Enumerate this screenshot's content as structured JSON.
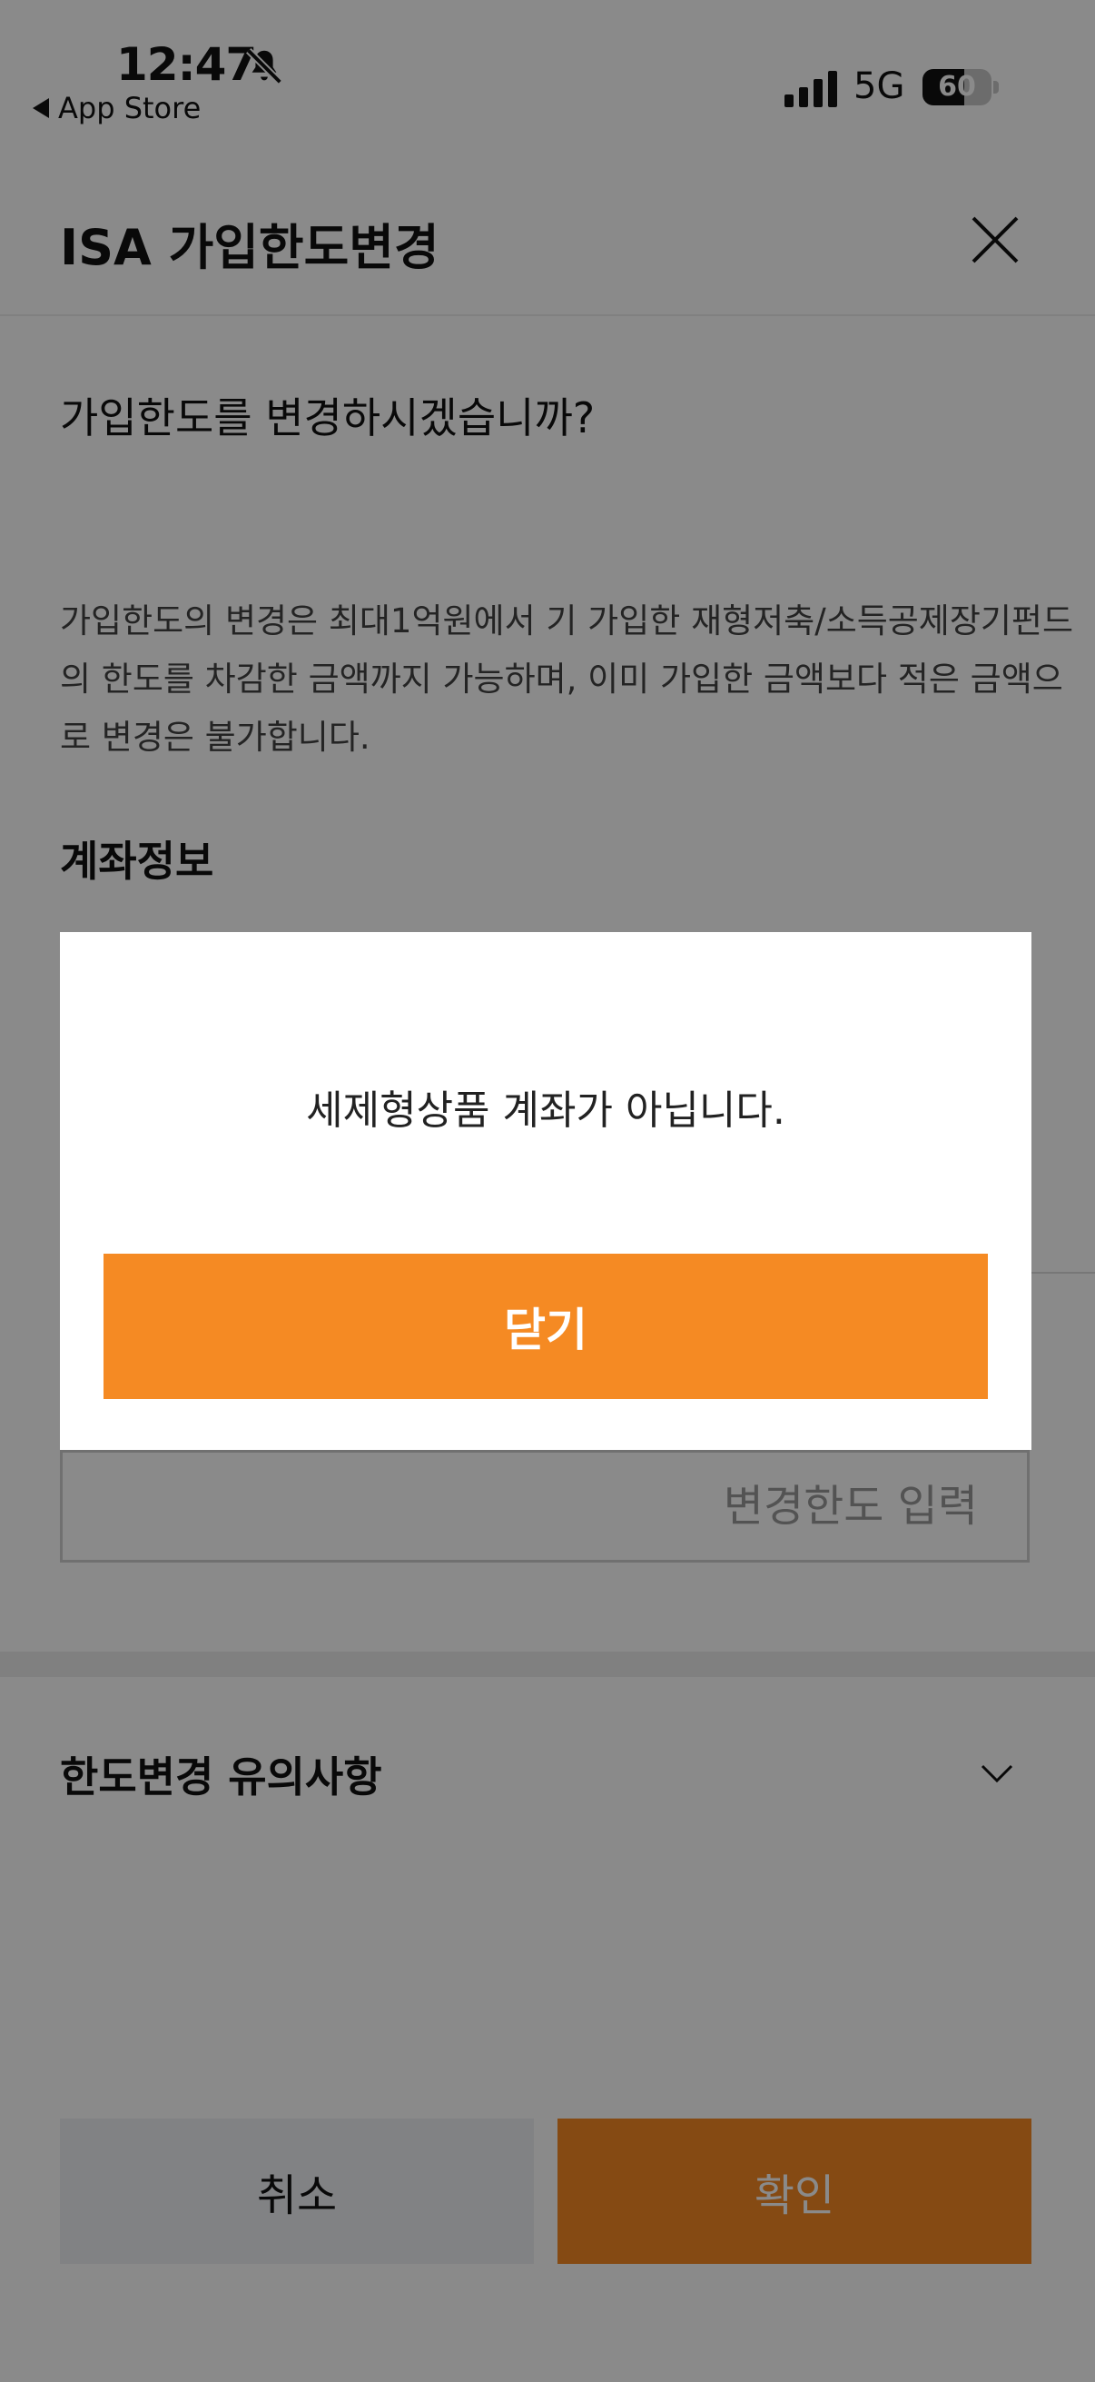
{
  "status_bar": {
    "time": "12:47",
    "back_label": "App Store",
    "network": "5G",
    "battery_level": "60",
    "battery_fraction": 0.6
  },
  "header": {
    "title": "ISA 가입한도변경"
  },
  "content": {
    "question": "가입한도를 변경하시겠습니까?",
    "description": "가입한도의 변경은 최대1억원에서 기 가입한 재형저축/소득공제장기펀드의 한도를 차감한 금액까지 가능하며, 이미 가입한 금액보다 적은 금액으로 변경은 불가합니다.",
    "account_info_title": "계좌정보",
    "limit_input_placeholder": "변경한도 입력",
    "notes_title": "한도변경 유의사항"
  },
  "buttons": {
    "cancel": "취소",
    "confirm": "확인"
  },
  "modal": {
    "message": "세제형상품 계좌가 아닙니다.",
    "close_label": "닫기"
  },
  "colors": {
    "accent": "#f58a23",
    "overlay": "rgba(0,0,0,0.46)"
  },
  "icons": {
    "bell": "bell-slash-icon",
    "close": "close-icon",
    "chevron": "chevron-down-icon",
    "signal": "cellular-signal-icon",
    "battery": "battery-icon"
  }
}
